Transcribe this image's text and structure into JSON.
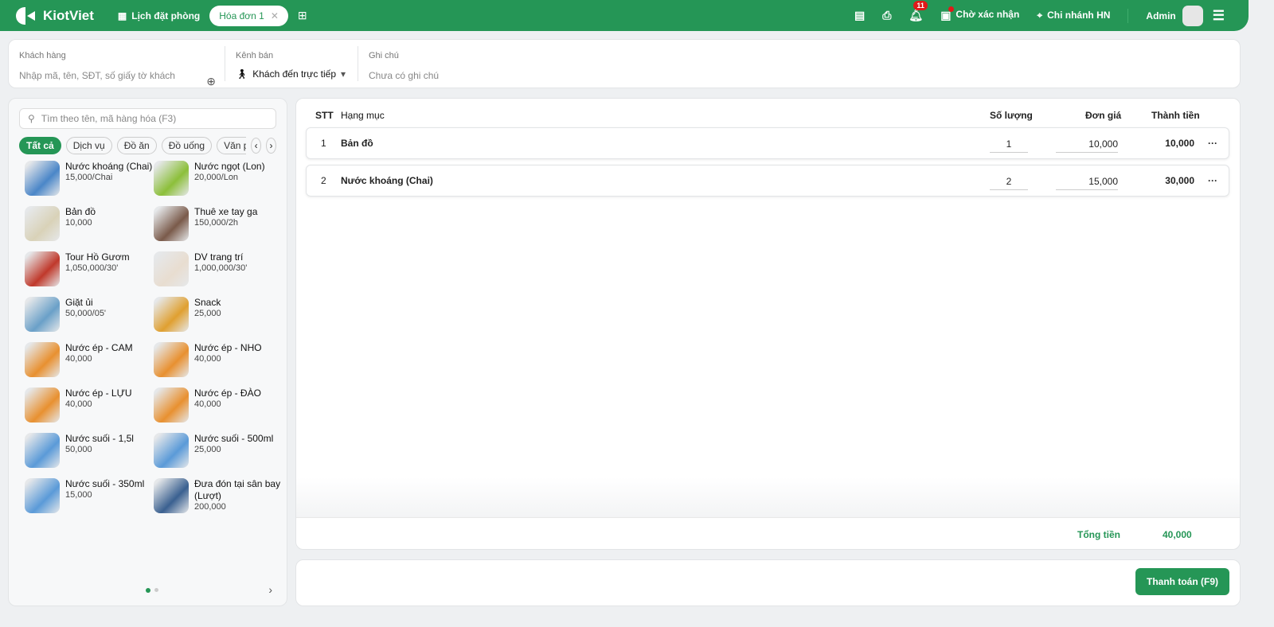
{
  "header": {
    "brand": "KiotViet",
    "booking": "Lịch đặt phòng",
    "tab": "Hóa đơn 1",
    "notifications": "11",
    "pending": "Chờ xác nhận",
    "branch": "Chi nhánh HN",
    "user": "Admin"
  },
  "customer": {
    "label": "Khách hàng",
    "placeholder": "Nhập mã, tên, SĐT, số giấy tờ khách",
    "channel_label": "Kênh bán",
    "channel": "Khách đến trực tiếp",
    "note_label": "Ghi chú",
    "note_placeholder": "Chưa có ghi chú"
  },
  "catalog": {
    "search_placeholder": "Tìm theo tên, mã hàng hóa (F3)",
    "categories": [
      "Tất cả",
      "Dịch vụ",
      "Đồ ăn",
      "Đồ uống",
      "Văn phò"
    ],
    "products": [
      {
        "name": "Nước khoáng (Chai)",
        "price": "15,000/Chai",
        "color": "#4a86c8"
      },
      {
        "name": "Nước ngọt (Lon)",
        "price": "20,000/Lon",
        "color": "#8cbf3a"
      },
      {
        "name": "Bản đồ",
        "price": "10,000",
        "color": "#d9d2b8"
      },
      {
        "name": "Thuê xe tay ga",
        "price": "150,000/2h",
        "color": "#7a5a4a"
      },
      {
        "name": "Tour Hồ Gươm",
        "price": "1,050,000/30'",
        "color": "#c0392b"
      },
      {
        "name": "DV trang trí",
        "price": "1,000,000/30'",
        "color": "#e8ddd0"
      },
      {
        "name": "Giặt ủi",
        "price": "50,000/05'",
        "color": "#6aa0c8"
      },
      {
        "name": "Snack",
        "price": "25,000",
        "color": "#e0a030"
      },
      {
        "name": "Nước ép - CAM",
        "price": "40,000",
        "color": "#e89030"
      },
      {
        "name": "Nước ép - NHO",
        "price": "40,000",
        "color": "#e89030"
      },
      {
        "name": "Nước ép - LỰU",
        "price": "40,000",
        "color": "#e89030"
      },
      {
        "name": "Nước ép - ĐÀO",
        "price": "40,000",
        "color": "#e89030"
      },
      {
        "name": "Nước suối - 1,5l",
        "price": "50,000",
        "color": "#5a9ad8"
      },
      {
        "name": "Nước suối - 500ml",
        "price": "25,000",
        "color": "#5a9ad8"
      },
      {
        "name": "Nước suối - 350ml",
        "price": "15,000",
        "color": "#5a9ad8"
      },
      {
        "name": "Đưa đón tại sân bay (Lượt)",
        "price": "200,000",
        "color": "#3a6090"
      }
    ]
  },
  "order": {
    "headers": {
      "stt": "STT",
      "item": "Hạng mục",
      "qty": "Số lượng",
      "price": "Đơn giá",
      "total": "Thành tiền"
    },
    "rows": [
      {
        "stt": "1",
        "item": "Bản đồ",
        "qty": "1",
        "price": "10,000",
        "total": "10,000"
      },
      {
        "stt": "2",
        "item": "Nước khoáng (Chai)",
        "qty": "2",
        "price": "15,000",
        "total": "30,000"
      }
    ],
    "total_label": "Tổng tiền",
    "total": "40,000",
    "pay": "Thanh toán (F9)"
  }
}
